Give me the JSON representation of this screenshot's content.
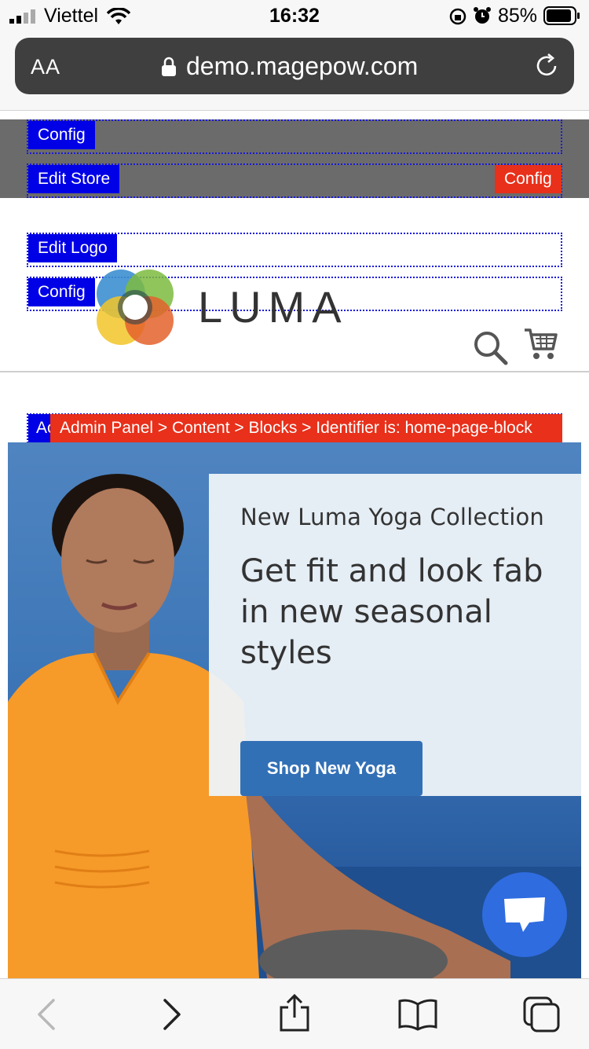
{
  "status_bar": {
    "carrier": "Viettel",
    "time": "16:32",
    "battery": "85%"
  },
  "browser": {
    "text_size_label": "AA",
    "url": "demo.magepow.com"
  },
  "admin_bars": {
    "config_1": "Config",
    "edit_store": "Edit Store",
    "config_store_right": "Config",
    "edit_logo": "Edit Logo",
    "config_logo": "Config",
    "block_left_tag": "Ac",
    "block_path": "Admin Panel > Content > Blocks > Identifier is: home-page-block"
  },
  "header": {
    "logo_text": "LUMA"
  },
  "hero": {
    "subtitle": "New Luma Yoga Collection",
    "headline": "Get fit and look fab in new seasonal styles",
    "cta_label": "Shop New Yoga"
  },
  "icons": {
    "search": "search-icon",
    "cart": "cart-icon",
    "chat": "chat-icon",
    "back": "back-arrow-icon",
    "forward": "forward-arrow-icon",
    "share": "share-icon",
    "bookmarks": "bookmarks-icon",
    "tabs": "tabs-icon"
  },
  "colors": {
    "admin_blue": "#0000e6",
    "admin_red": "#e8301a",
    "cta_blue": "#3270b6",
    "chat_blue": "#2f6ce0"
  }
}
